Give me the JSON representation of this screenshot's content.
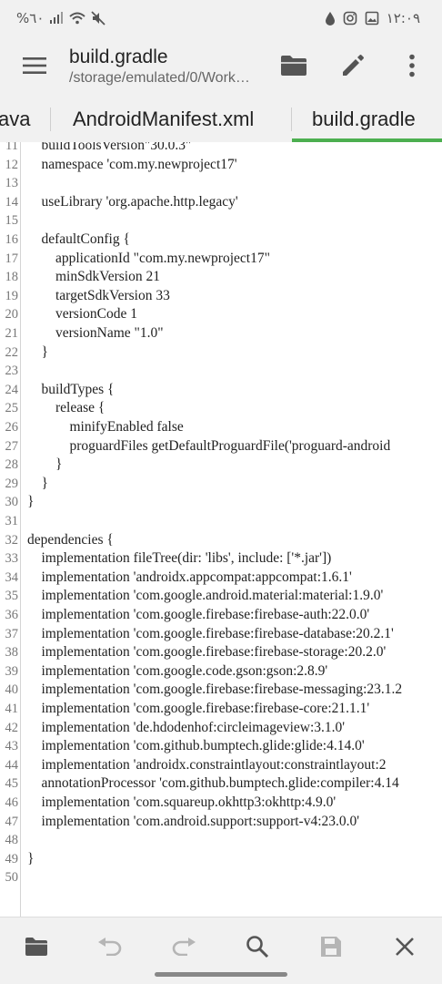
{
  "status_bar": {
    "left_text": "%٦٠",
    "time": "١٢:٠٩"
  },
  "app_bar": {
    "title": "build.gradle",
    "subtitle": "/storage/emulated/0/Work…"
  },
  "tabs": [
    {
      "label": "ava",
      "active": false
    },
    {
      "label": "AndroidManifest.xml",
      "active": false
    },
    {
      "label": "build.gradle",
      "active": true
    }
  ],
  "colors": {
    "accent": "#4caf50",
    "bar_bg": "#f1f1f1",
    "icon": "#555555",
    "disabled_icon": "#b5b5b5"
  },
  "icons": {
    "menu": "hamburger-icon",
    "open": "folder-icon",
    "edit": "pencil-icon",
    "more": "more-vertical-icon",
    "undo": "undo-icon",
    "redo": "redo-icon",
    "search": "search-icon",
    "save": "save-icon",
    "close": "close-icon"
  },
  "editor": {
    "lines": [
      {
        "n": "11",
        "text": "    buildToolsVersion\"30.0.3\""
      },
      {
        "n": "12",
        "text": "    namespace 'com.my.newproject17'"
      },
      {
        "n": "13",
        "text": ""
      },
      {
        "n": "14",
        "text": "    useLibrary 'org.apache.http.legacy'"
      },
      {
        "n": "15",
        "text": ""
      },
      {
        "n": "16",
        "text": "    defaultConfig {"
      },
      {
        "n": "17",
        "text": "        applicationId \"com.my.newproject17\""
      },
      {
        "n": "18",
        "text": "        minSdkVersion 21"
      },
      {
        "n": "19",
        "text": "        targetSdkVersion 33"
      },
      {
        "n": "20",
        "text": "        versionCode 1"
      },
      {
        "n": "21",
        "text": "        versionName \"1.0\""
      },
      {
        "n": "22",
        "text": "    }"
      },
      {
        "n": "23",
        "text": ""
      },
      {
        "n": "24",
        "text": "    buildTypes {"
      },
      {
        "n": "25",
        "text": "        release {"
      },
      {
        "n": "26",
        "text": "            minifyEnabled false"
      },
      {
        "n": "27",
        "text": "            proguardFiles getDefaultProguardFile('proguard-android"
      },
      {
        "n": "28",
        "text": "        }"
      },
      {
        "n": "29",
        "text": "    }"
      },
      {
        "n": "30",
        "text": "}"
      },
      {
        "n": "31",
        "text": ""
      },
      {
        "n": "32",
        "text": "dependencies {"
      },
      {
        "n": "33",
        "text": "    implementation fileTree(dir: 'libs', include: ['*.jar'])"
      },
      {
        "n": "34",
        "text": "    implementation 'androidx.appcompat:appcompat:1.6.1'"
      },
      {
        "n": "35",
        "text": "    implementation 'com.google.android.material:material:1.9.0'"
      },
      {
        "n": "36",
        "text": "    implementation 'com.google.firebase:firebase-auth:22.0.0'"
      },
      {
        "n": "37",
        "text": "    implementation 'com.google.firebase:firebase-database:20.2.1'"
      },
      {
        "n": "38",
        "text": "    implementation 'com.google.firebase:firebase-storage:20.2.0'"
      },
      {
        "n": "39",
        "text": "    implementation 'com.google.code.gson:gson:2.8.9'"
      },
      {
        "n": "40",
        "text": "    implementation 'com.google.firebase:firebase-messaging:23.1.2"
      },
      {
        "n": "41",
        "text": "    implementation 'com.google.firebase:firebase-core:21.1.1'"
      },
      {
        "n": "42",
        "text": "    implementation 'de.hdodenhof:circleimageview:3.1.0'"
      },
      {
        "n": "43",
        "text": "    implementation 'com.github.bumptech.glide:glide:4.14.0'"
      },
      {
        "n": "44",
        "text": "    implementation 'androidx.constraintlayout:constraintlayout:2"
      },
      {
        "n": "45",
        "text": "    annotationProcessor 'com.github.bumptech.glide:compiler:4.14"
      },
      {
        "n": "46",
        "text": "    implementation 'com.squareup.okhttp3:okhttp:4.9.0'"
      },
      {
        "n": "47",
        "text": "    implementation 'com.android.support:support-v4:23.0.0'"
      },
      {
        "n": "48",
        "text": ""
      },
      {
        "n": "49",
        "text": "}"
      },
      {
        "n": "50",
        "text": ""
      }
    ]
  }
}
